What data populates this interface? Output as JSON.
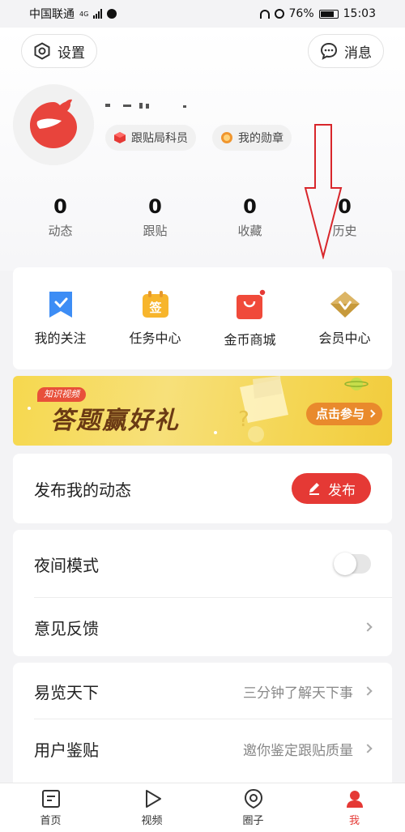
{
  "status_bar": {
    "carrier": "中国联通",
    "network": "4G",
    "battery": "76%",
    "time": "15:03",
    "battery_level": 0.76
  },
  "header": {
    "settings_label": "设置",
    "messages_label": "消息"
  },
  "profile": {
    "badges": [
      {
        "label": "跟贴局科员",
        "icon": "red-cube-icon",
        "color": "#e53935"
      },
      {
        "label": "我的勋章",
        "icon": "medal-icon",
        "color": "#f0962e"
      }
    ]
  },
  "stats": [
    {
      "value": "0",
      "label": "动态"
    },
    {
      "value": "0",
      "label": "跟贴"
    },
    {
      "value": "0",
      "label": "收藏"
    },
    {
      "value": "0",
      "label": "历史"
    }
  ],
  "shortcuts": [
    {
      "label": "我的关注",
      "icon": "bookmark-icon",
      "color": "#3d8df5"
    },
    {
      "label": "任务中心",
      "icon": "task-sign-icon",
      "color": "#f7b52c"
    },
    {
      "label": "金币商城",
      "icon": "shopping-bag-icon",
      "color": "#f04a3a"
    },
    {
      "label": "会员中心",
      "icon": "vip-diamond-icon",
      "color": "#c79a3c"
    }
  ],
  "banner": {
    "tag": "知识视频",
    "title": "答题赢好礼",
    "cta": "点击参与"
  },
  "publish": {
    "label": "发布我的动态",
    "button": "发布"
  },
  "settings_rows": {
    "night_mode": "夜间模式",
    "night_mode_on": false,
    "feedback": "意见反馈"
  },
  "feature_rows": [
    {
      "label": "易览天下",
      "hint": "三分钟了解天下事"
    },
    {
      "label": "用户鉴贴",
      "hint": "邀你鉴定跟贴质量"
    }
  ],
  "tabbar": [
    {
      "label": "首页",
      "icon": "home-icon"
    },
    {
      "label": "视频",
      "icon": "play-icon"
    },
    {
      "label": "圈子",
      "icon": "circle-location-icon"
    },
    {
      "label": "我",
      "icon": "profile-icon"
    }
  ],
  "colors": {
    "accent": "#e53935",
    "background": "#f3f3f5"
  }
}
